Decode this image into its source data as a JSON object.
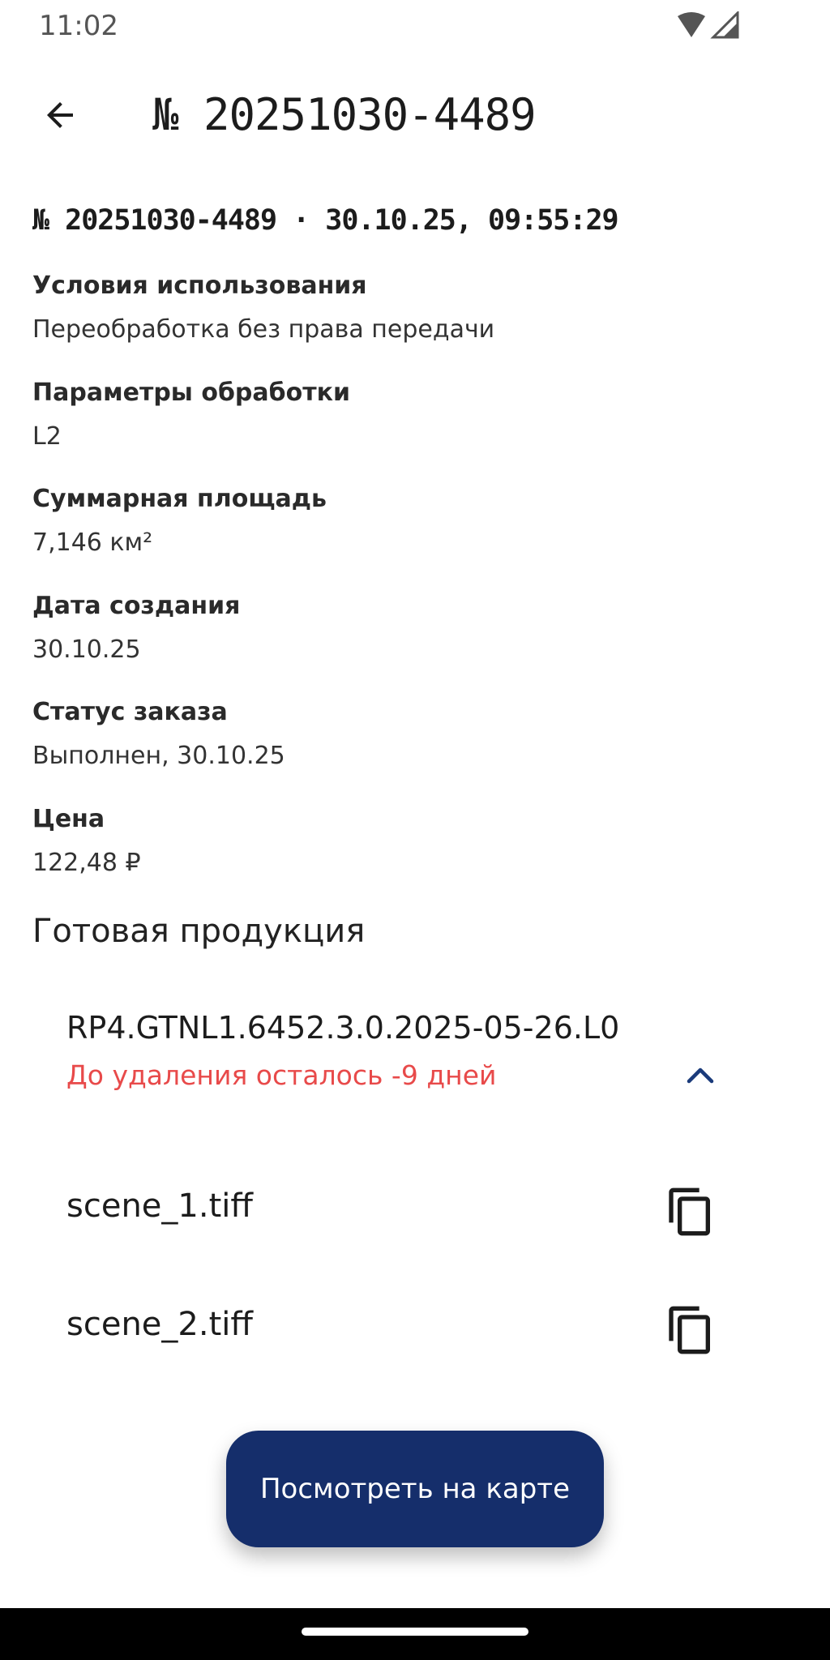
{
  "status_bar": {
    "time": "11:02"
  },
  "app_bar": {
    "title": "№ 20251030-4489"
  },
  "order": {
    "header": "№ 20251030-4489 · 30.10.25, 09:55:29",
    "details": [
      {
        "label": "Условия использования",
        "value": "Переобработка без права передачи"
      },
      {
        "label": "Параметры обработки",
        "value": "L2"
      },
      {
        "label": "Суммарная площадь",
        "value": "7,146 км²"
      },
      {
        "label": "Дата создания",
        "value": "30.10.25"
      },
      {
        "label": "Статус заказа",
        "value": "Выполнен, 30.10.25"
      },
      {
        "label": "Цена",
        "value": "122,48 ₽"
      }
    ]
  },
  "products": {
    "section_title": "Готовая продукция",
    "item_name": "RP4.GTNL1.6452.3.0.2025-05-26.L0",
    "expiry_text": "До удаления осталось -9 дней",
    "files": [
      {
        "name": "scene_1.tiff"
      },
      {
        "name": "scene_2.tiff"
      }
    ]
  },
  "actions": {
    "map_button_label": "Посмотреть на карте"
  },
  "colors": {
    "primary": "#152e6b",
    "warning": "#e84a4a",
    "chevron": "#1a3a7a"
  }
}
